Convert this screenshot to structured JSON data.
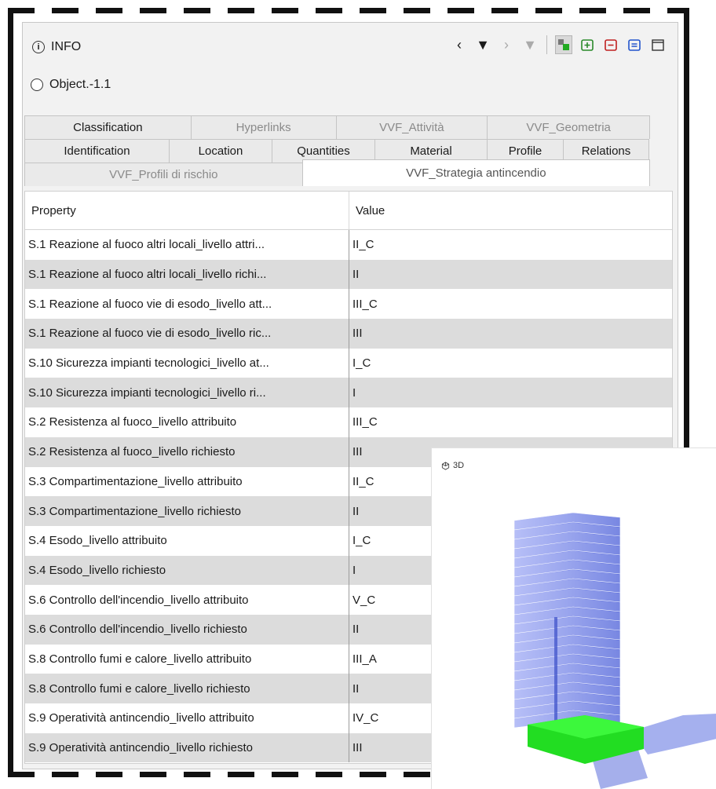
{
  "header": {
    "title": "INFO"
  },
  "object": {
    "name": "Object.-1.1"
  },
  "toolbar": {
    "icons": [
      "chevron-left-icon",
      "caret-down-icon",
      "chevron-right-icon",
      "caret-down-icon",
      "objects-toggle-icon",
      "add-set-icon",
      "remove-set-icon",
      "set-list-icon",
      "window-icon"
    ]
  },
  "tabs": {
    "row1": [
      "Classification",
      "Hyperlinks",
      "VVF_Attività",
      "VVF_Geometria"
    ],
    "row2": [
      "Identification",
      "Location",
      "Quantities",
      "Material",
      "Profile",
      "Relations"
    ],
    "row3": [
      "VVF_Profili di rischio",
      "VVF_Strategia antincendio"
    ]
  },
  "table": {
    "headers": {
      "property": "Property",
      "value": "Value"
    },
    "rows": [
      {
        "p": "S.1 Reazione al fuoco altri locali_livello attri...",
        "v": "II_C"
      },
      {
        "p": "S.1 Reazione al fuoco altri locali_livello richi...",
        "v": "II"
      },
      {
        "p": "S.1 Reazione al fuoco vie di esodo_livello att...",
        "v": "III_C"
      },
      {
        "p": "S.1 Reazione al fuoco vie di esodo_livello ric...",
        "v": "III"
      },
      {
        "p": "S.10 Sicurezza impianti tecnologici_livello at...",
        "v": "I_C"
      },
      {
        "p": "S.10 Sicurezza impianti tecnologici_livello ri...",
        "v": "I"
      },
      {
        "p": "S.2 Resistenza al fuoco_livello attribuito",
        "v": "III_C"
      },
      {
        "p": "S.2 Resistenza al fuoco_livello richiesto",
        "v": "III"
      },
      {
        "p": "S.3 Compartimentazione_livello attribuito",
        "v": "II_C"
      },
      {
        "p": "S.3 Compartimentazione_livello richiesto",
        "v": "II"
      },
      {
        "p": "S.4 Esodo_livello attribuito",
        "v": "I_C"
      },
      {
        "p": "S.4 Esodo_livello richiesto",
        "v": "I"
      },
      {
        "p": "S.6 Controllo dell'incendio_livello attribuito",
        "v": "V_C"
      },
      {
        "p": "S.6 Controllo dell'incendio_livello richiesto",
        "v": "II"
      },
      {
        "p": "S.8 Controllo fumi e calore_livello attribuito",
        "v": "III_A"
      },
      {
        "p": "S.8 Controllo fumi e calore_livello richiesto",
        "v": "II"
      },
      {
        "p": "S.9 Operatività antincendio_livello attribuito",
        "v": "IV_C"
      },
      {
        "p": "S.9 Operatività antincendio_livello richiesto",
        "v": "III"
      }
    ]
  },
  "viewer": {
    "label": "3D"
  },
  "colors": {
    "building": "#5b6fe0",
    "highlight": "#22dd22"
  }
}
